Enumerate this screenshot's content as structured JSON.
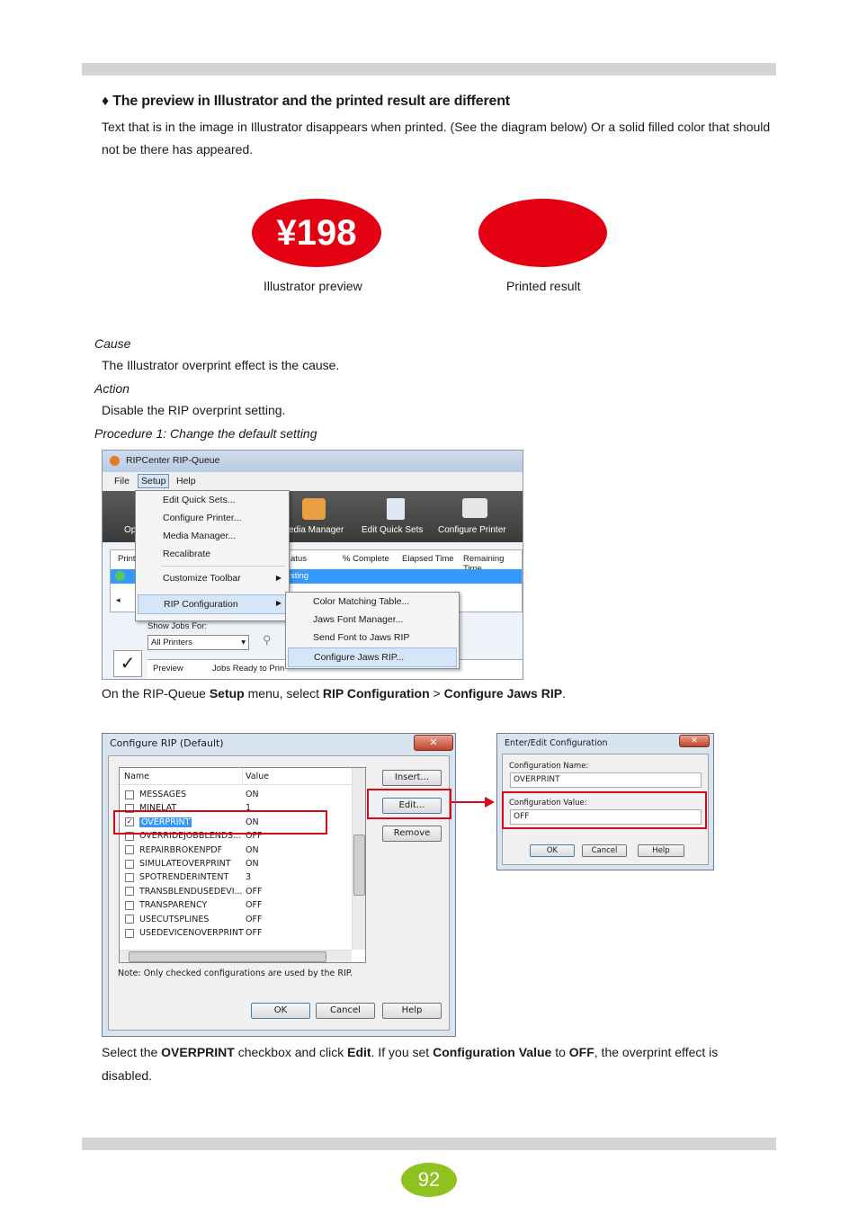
{
  "heading": "♦  The preview in Illustrator and the printed result are different",
  "intro_text": "Text that is in the image in Illustrator disappears when printed. (See the diagram below) Or a solid filled color that should not be there has appeared.",
  "diagram": {
    "preview_price": "¥198",
    "preview_caption": "Illustrator preview",
    "result_caption": "Printed result",
    "red_color": "#e30012"
  },
  "cause_label": "Cause",
  "cause_text": "The Illustrator overprint effect is the cause.",
  "action_label": "Action",
  "action_text": "Disable the RIP overprint setting.",
  "procedure_label": "Procedure 1: Change the default setting",
  "ripqueue": {
    "title": "RIPCenter RIP-Queue",
    "menubar": [
      "File",
      "Setup",
      "Help"
    ],
    "setup_menu": [
      "Edit Quick Sets...",
      "Configure Printer...",
      "Media Manager...",
      "Recalibrate",
      "Customize Toolbar",
      "RIP Configuration"
    ],
    "submenu": [
      "Color Matching Table...",
      "Jaws Font Manager...",
      "Send Font to Jaws RIP",
      "Configure Jaws  RIP..."
    ],
    "toolbar": [
      "Op",
      "edia Manager",
      "Edit Quick Sets",
      "Configure Printer"
    ],
    "columns": [
      "Print",
      "atus",
      "% Complete",
      "Elapsed Time",
      "Remaining Time"
    ],
    "status_cell": "sting",
    "show_jobs_label": "Show Jobs For:",
    "printers_select": "All Printers",
    "bottom_tabs": [
      "Preview",
      "Jobs Ready to Prin"
    ]
  },
  "step1_text": {
    "a": "On the RIP-Queue ",
    "b": "Setup",
    "c": " menu, select ",
    "d": "RIP Configuration",
    "e": " > ",
    "f": "Configure Jaws RIP",
    "g": "."
  },
  "configure_rip": {
    "title": "Configure RIP (Default)",
    "col_name": "Name",
    "col_value": "Value",
    "rows": [
      {
        "name": "MESSAGES",
        "value": "ON",
        "checked": false
      },
      {
        "name": "MINELAT",
        "value": "1",
        "checked": false
      },
      {
        "name": "OVERPRINT",
        "value": "ON",
        "checked": true
      },
      {
        "name": "OVERRIDEJOBBLENDS...",
        "value": "OFF",
        "checked": false
      },
      {
        "name": "REPAIRBROKENPDF",
        "value": "ON",
        "checked": false
      },
      {
        "name": "SIMULATEOVERPRINT",
        "value": "ON",
        "checked": false
      },
      {
        "name": "SPOTRENDERINTENT",
        "value": "3",
        "checked": false
      },
      {
        "name": "TRANSBLENDUSEDEVI...",
        "value": "OFF",
        "checked": false
      },
      {
        "name": "TRANSPARENCY",
        "value": "OFF",
        "checked": false
      },
      {
        "name": "USECUTSPLINES",
        "value": "OFF",
        "checked": false
      },
      {
        "name": "USEDEVICENOVERPRINT",
        "value": "OFF",
        "checked": false
      }
    ],
    "insert_btn": "Insert...",
    "edit_btn": "Edit...",
    "remove_btn": "Remove",
    "note": "Note: Only checked configurations are used by the RIP.",
    "ok_btn": "OK",
    "cancel_btn": "Cancel",
    "help_btn": "Help"
  },
  "enter_edit": {
    "title": "Enter/Edit Configuration",
    "name_label": "Configuration Name:",
    "name_value": "OVERPRINT",
    "value_label": "Configuration Value:",
    "value_value": "OFF",
    "ok_btn": "OK",
    "cancel_btn": "Cancel",
    "help_btn": "Help"
  },
  "step2_text": {
    "a": "Select the ",
    "b": "OVERPRINT",
    "c": " checkbox and click ",
    "d": "Edit",
    "e": ". If you set ",
    "f": "Configuration Value",
    "g": " to ",
    "h": "OFF",
    "i": ", the overprint effect is disabled."
  },
  "page_number": "92",
  "page_number_color": "#8dc21f"
}
